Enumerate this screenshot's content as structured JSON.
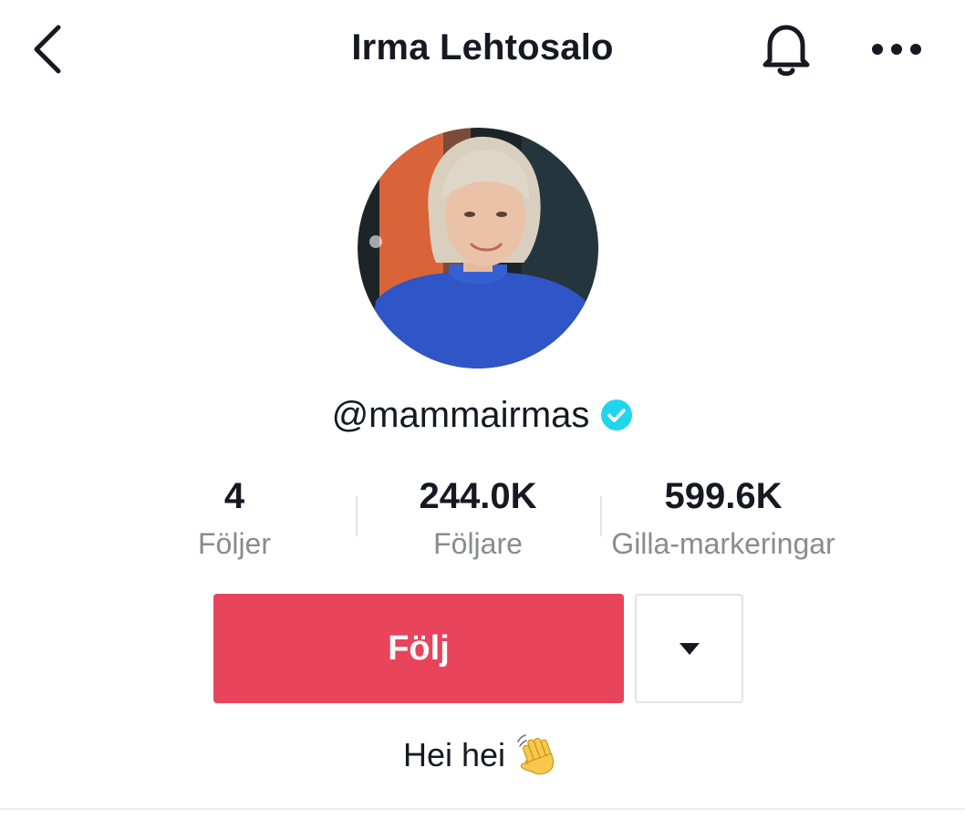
{
  "header": {
    "title": "Irma Lehtosalo",
    "back_icon": "chevron-left-icon",
    "bell_icon": "bell-icon",
    "more_icon": "more-horizontal-icon"
  },
  "profile": {
    "handle": "@mammairmas",
    "verified_icon": "verified-badge-icon",
    "bio": "Hei hei",
    "bio_emoji": "waving-hand-emoji"
  },
  "stats": [
    {
      "value": "4",
      "label": "Följer"
    },
    {
      "value": "244.0K",
      "label": "Följare"
    },
    {
      "value": "599.6K",
      "label": "Gilla-markeringar"
    }
  ],
  "actions": {
    "follow_label": "Följ",
    "dropdown_icon": "caret-down-icon"
  },
  "colors": {
    "accent": "#e8445c",
    "verified": "#20d5ec",
    "muted_text": "#8a8b91",
    "primary_text": "#161823"
  }
}
